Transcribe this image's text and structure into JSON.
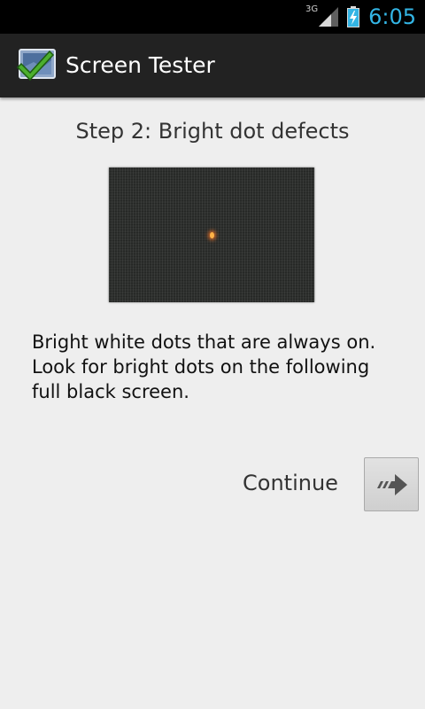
{
  "status_bar": {
    "network_type": "3G",
    "time": "6:05",
    "signal_icon": "signal-bars-icon",
    "battery_icon": "battery-charging-icon"
  },
  "action_bar": {
    "app_icon": "check-screen-icon",
    "title": "Screen Tester"
  },
  "main": {
    "step_title": "Step 2: Bright dot defects",
    "preview_image": "bright-dot-sample-image",
    "description_lines": [
      "Bright white dots that are always on.",
      "Look for bright dots on the following",
      "full black screen."
    ],
    "continue_label": "Continue",
    "continue_icon": "arrow-right-icon"
  },
  "colors": {
    "clock": "#33b5e5",
    "action_bar": "#222222",
    "background": "#eeeeee"
  }
}
